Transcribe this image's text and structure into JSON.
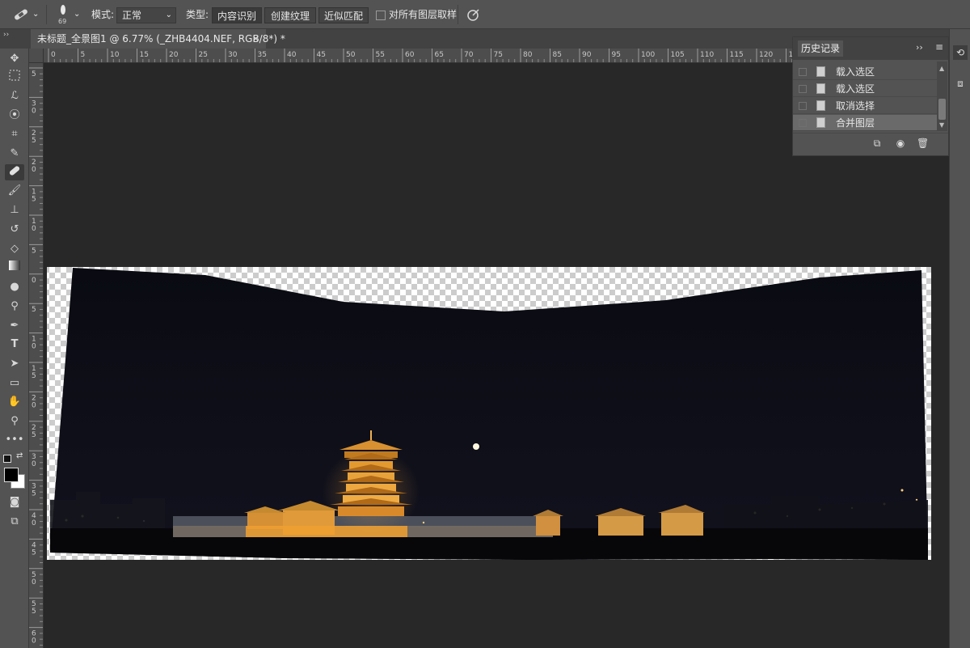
{
  "options_bar": {
    "brush_size": "69",
    "mode_label": "模式:",
    "mode_value": "正常",
    "type_label": "类型:",
    "type_buttons": [
      "内容识别",
      "创建纹理",
      "近似匹配"
    ],
    "sample_all_layers": "对所有图层取样"
  },
  "document_tab": {
    "title": "未标题_全景图1 @ 6.77% (_ZHB4404.NEF, RGB/8*) *",
    "close": "×"
  },
  "ruler": {
    "h_labels": [
      "0",
      "5",
      "10",
      "15",
      "20",
      "25",
      "30",
      "35",
      "40",
      "45",
      "50",
      "55",
      "60",
      "65",
      "70",
      "75",
      "80",
      "85",
      "90",
      "95",
      "100",
      "105",
      "110",
      "115",
      "120",
      "12"
    ],
    "v_labels": [
      [
        "5"
      ],
      [
        "3",
        "0"
      ],
      [
        "2",
        "5"
      ],
      [
        "2",
        "0"
      ],
      [
        "1",
        "5"
      ],
      [
        "1",
        "0"
      ],
      [
        "5"
      ],
      [
        "0"
      ],
      [
        "5"
      ],
      [
        "1",
        "0"
      ],
      [
        "1",
        "5"
      ],
      [
        "2",
        "0"
      ],
      [
        "2",
        "5"
      ],
      [
        "3",
        "0"
      ],
      [
        "3",
        "5"
      ],
      [
        "4",
        "0"
      ],
      [
        "4",
        "5"
      ],
      [
        "5",
        "0"
      ],
      [
        "5",
        "5"
      ],
      [
        "6",
        "0"
      ]
    ]
  },
  "history_panel": {
    "title": "历史记录",
    "collapse": "››",
    "menu": "≡",
    "items": [
      {
        "label": "载入选区",
        "selected": false
      },
      {
        "label": "载入选区",
        "selected": false
      },
      {
        "label": "取消选择",
        "selected": false
      },
      {
        "label": "合并图层",
        "selected": true
      }
    ]
  },
  "colors": {
    "ui_panel": "#535353",
    "canvas_bg": "#282828",
    "night_sky": "#0c0c14",
    "lights": "#f0a030"
  }
}
